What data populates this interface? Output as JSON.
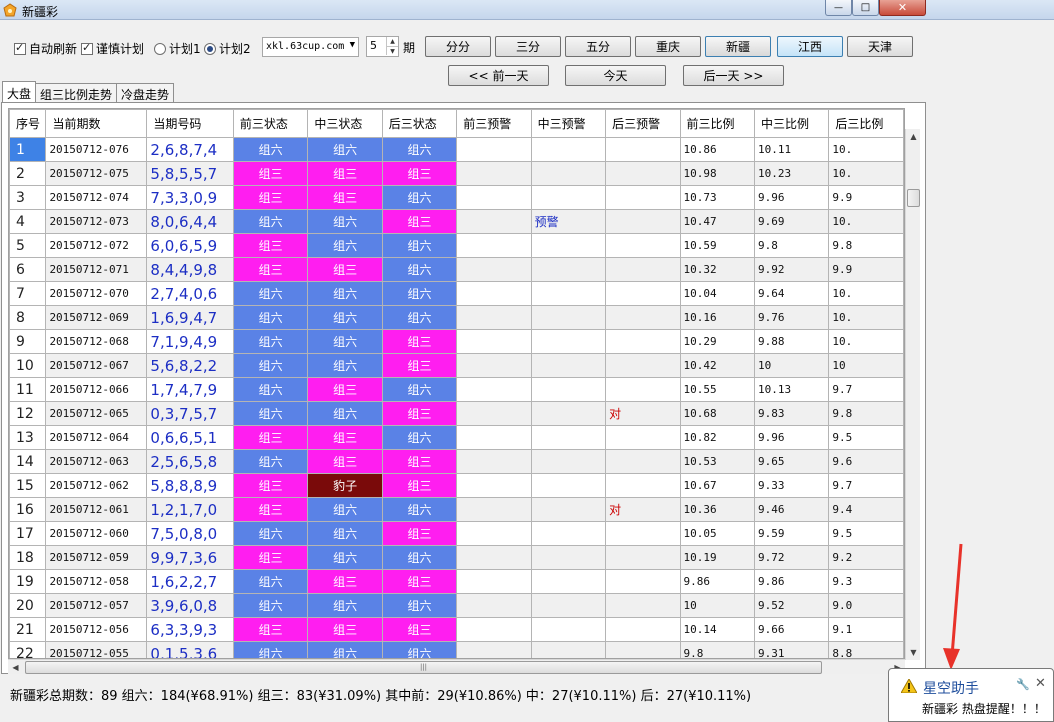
{
  "window": {
    "title": "新疆彩",
    "minimize_label": "—",
    "maximize_label": "□",
    "close_label": "✕"
  },
  "toolbar": {
    "auto_refresh_label": "自动刷新",
    "auto_refresh_checked": true,
    "cautious_plan_label": "谨慎计划",
    "cautious_plan_checked": true,
    "plan1_label": "计划1",
    "plan2_label": "计划2",
    "selected_plan": "计划2",
    "source_value": "xkl.63cup.com",
    "periods_value": "5",
    "periods_unit": "期",
    "interval_buttons": [
      "分分",
      "三分",
      "五分"
    ],
    "region_buttons": [
      "重庆",
      "新疆",
      "江西",
      "天津"
    ],
    "selected_region": "新疆",
    "highlight_region": "江西",
    "prev_day_label": "<<  前一天",
    "today_label": "今天",
    "next_day_label": "后一天  >>"
  },
  "tabs": [
    "大盘",
    "组三比例走势",
    "冷盘走势"
  ],
  "active_tab": "大盘",
  "grid": {
    "columns": [
      "序号",
      "当前期数",
      "当期号码",
      "前三状态",
      "中三状态",
      "后三状态",
      "前三预警",
      "中三预警",
      "后三预警",
      "前三比例",
      "中三比例",
      "后三比例"
    ],
    "rows": [
      {
        "seq": "1",
        "period": "20150712-076",
        "code": "2,6,8,7,4",
        "s1": "组六",
        "s2": "组六",
        "s3": "组六",
        "w1": "",
        "w2": "",
        "w3": "",
        "r1": "10.86",
        "r2": "10.11",
        "r3": "10."
      },
      {
        "seq": "2",
        "period": "20150712-075",
        "code": "5,8,5,5,7",
        "s1": "组三",
        "s2": "组三",
        "s3": "组三",
        "w1": "",
        "w2": "",
        "w3": "",
        "r1": "10.98",
        "r2": "10.23",
        "r3": "10."
      },
      {
        "seq": "3",
        "period": "20150712-074",
        "code": "7,3,3,0,9",
        "s1": "组三",
        "s2": "组三",
        "s3": "组六",
        "w1": "",
        "w2": "",
        "w3": "",
        "r1": "10.73",
        "r2": "9.96",
        "r3": "9.9"
      },
      {
        "seq": "4",
        "period": "20150712-073",
        "code": "8,0,6,4,4",
        "s1": "组六",
        "s2": "组六",
        "s3": "组三",
        "w1": "",
        "w2": "预警",
        "w3": "",
        "r1": "10.47",
        "r2": "9.69",
        "r3": "10."
      },
      {
        "seq": "5",
        "period": "20150712-072",
        "code": "6,0,6,5,9",
        "s1": "组三",
        "s2": "组六",
        "s3": "组六",
        "w1": "",
        "w2": "",
        "w3": "",
        "r1": "10.59",
        "r2": "9.8",
        "r3": "9.8"
      },
      {
        "seq": "6",
        "period": "20150712-071",
        "code": "8,4,4,9,8",
        "s1": "组三",
        "s2": "组三",
        "s3": "组六",
        "w1": "",
        "w2": "",
        "w3": "",
        "r1": "10.32",
        "r2": "9.92",
        "r3": "9.9"
      },
      {
        "seq": "7",
        "period": "20150712-070",
        "code": "2,7,4,0,6",
        "s1": "组六",
        "s2": "组六",
        "s3": "组六",
        "w1": "",
        "w2": "",
        "w3": "",
        "r1": "10.04",
        "r2": "9.64",
        "r3": "10."
      },
      {
        "seq": "8",
        "period": "20150712-069",
        "code": "1,6,9,4,7",
        "s1": "组六",
        "s2": "组六",
        "s3": "组六",
        "w1": "",
        "w2": "",
        "w3": "",
        "r1": "10.16",
        "r2": "9.76",
        "r3": "10."
      },
      {
        "seq": "9",
        "period": "20150712-068",
        "code": "7,1,9,4,9",
        "s1": "组六",
        "s2": "组六",
        "s3": "组三",
        "w1": "",
        "w2": "",
        "w3": "",
        "r1": "10.29",
        "r2": "9.88",
        "r3": "10."
      },
      {
        "seq": "10",
        "period": "20150712-067",
        "code": "5,6,8,2,2",
        "s1": "组六",
        "s2": "组六",
        "s3": "组三",
        "w1": "",
        "w2": "",
        "w3": "",
        "r1": "10.42",
        "r2": "10",
        "r3": "10"
      },
      {
        "seq": "11",
        "period": "20150712-066",
        "code": "1,7,4,7,9",
        "s1": "组六",
        "s2": "组三",
        "s3": "组六",
        "w1": "",
        "w2": "",
        "w3": "",
        "r1": "10.55",
        "r2": "10.13",
        "r3": "9.7"
      },
      {
        "seq": "12",
        "period": "20150712-065",
        "code": "0,3,7,5,7",
        "s1": "组六",
        "s2": "组六",
        "s3": "组三",
        "w1": "",
        "w2": "",
        "w3": "对",
        "r1": "10.68",
        "r2": "9.83",
        "r3": "9.8"
      },
      {
        "seq": "13",
        "period": "20150712-064",
        "code": "0,6,6,5,1",
        "s1": "组三",
        "s2": "组三",
        "s3": "组六",
        "w1": "",
        "w2": "",
        "w3": "",
        "r1": "10.82",
        "r2": "9.96",
        "r3": "9.5"
      },
      {
        "seq": "14",
        "period": "20150712-063",
        "code": "2,5,6,5,8",
        "s1": "组六",
        "s2": "组三",
        "s3": "组三",
        "w1": "",
        "w2": "",
        "w3": "",
        "r1": "10.53",
        "r2": "9.65",
        "r3": "9.6"
      },
      {
        "seq": "15",
        "period": "20150712-062",
        "code": "5,8,8,8,9",
        "s1": "组三",
        "s2": "豹子",
        "s3": "组三",
        "w1": "",
        "w2": "",
        "w3": "",
        "r1": "10.67",
        "r2": "9.33",
        "r3": "9.7"
      },
      {
        "seq": "16",
        "period": "20150712-061",
        "code": "1,2,1,7,0",
        "s1": "组三",
        "s2": "组六",
        "s3": "组六",
        "w1": "",
        "w2": "",
        "w3": "对",
        "r1": "10.36",
        "r2": "9.46",
        "r3": "9.4"
      },
      {
        "seq": "17",
        "period": "20150712-060",
        "code": "7,5,0,8,0",
        "s1": "组六",
        "s2": "组六",
        "s3": "组三",
        "w1": "",
        "w2": "",
        "w3": "",
        "r1": "10.05",
        "r2": "9.59",
        "r3": "9.5"
      },
      {
        "seq": "18",
        "period": "20150712-059",
        "code": "9,9,7,3,6",
        "s1": "组三",
        "s2": "组六",
        "s3": "组六",
        "w1": "",
        "w2": "",
        "w3": "",
        "r1": "10.19",
        "r2": "9.72",
        "r3": "9.2"
      },
      {
        "seq": "19",
        "period": "20150712-058",
        "code": "1,6,2,2,7",
        "s1": "组六",
        "s2": "组三",
        "s3": "组三",
        "w1": "",
        "w2": "",
        "w3": "",
        "r1": "9.86",
        "r2": "9.86",
        "r3": "9.3"
      },
      {
        "seq": "20",
        "period": "20150712-057",
        "code": "3,9,6,0,8",
        "s1": "组六",
        "s2": "组六",
        "s3": "组六",
        "w1": "",
        "w2": "",
        "w3": "",
        "r1": "10",
        "r2": "9.52",
        "r3": "9.0"
      },
      {
        "seq": "21",
        "period": "20150712-056",
        "code": "6,3,3,9,3",
        "s1": "组三",
        "s2": "组三",
        "s3": "组三",
        "w1": "",
        "w2": "",
        "w3": "",
        "r1": "10.14",
        "r2": "9.66",
        "r3": "9.1"
      },
      {
        "seq": "22",
        "period": "20150712-055",
        "code": "0,1,5,3,6",
        "s1": "组六",
        "s2": "组六",
        "s3": "组六",
        "w1": "",
        "w2": "",
        "w3": "",
        "r1": "9.8",
        "r2": "9.31",
        "r3": "8.8"
      }
    ]
  },
  "status_bar": {
    "text": "新疆彩总期数：89 组六：184(¥68.91%) 组三：83(¥31.09%)  其中前：29(¥10.86%)  中：27(¥10.11%)      后：27(¥10.11%)"
  },
  "notification": {
    "title": "星空助手",
    "message": "新疆彩 热盘提醒！！！",
    "pin_label": "🔧",
    "close_label": "✕"
  },
  "colors": {
    "group6": "#5a82e6",
    "group3": "#ff1ef0",
    "leopard": "#7a0a0a",
    "seq_highlight": "#3e82e6",
    "code_text": "#1c2ec4",
    "warn_text": "#cc0000",
    "annotation_arrow": "#e8322a"
  }
}
